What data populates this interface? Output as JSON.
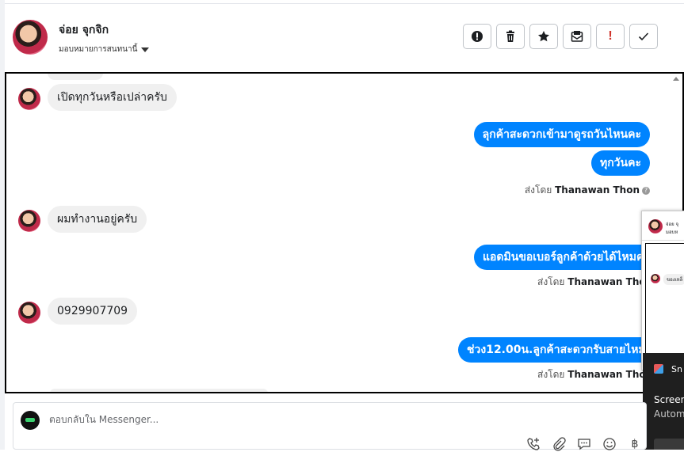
{
  "header": {
    "contact_name": "จ่อย จุกจิก",
    "assign_label": "มอบหมายการสนทนานี้",
    "toolbar": [
      {
        "icon": "alert-circle-icon",
        "label": ""
      },
      {
        "icon": "trash-icon",
        "label": ""
      },
      {
        "icon": "star-icon",
        "label": ""
      },
      {
        "icon": "mark-unread-icon",
        "label": ""
      },
      {
        "icon": "exclamation-icon",
        "label": "!"
      },
      {
        "icon": "checkmark-icon",
        "label": ""
      }
    ]
  },
  "messages": [
    {
      "direction": "in",
      "text": "เปิดทุกวันหรือเปล่าครับ"
    },
    {
      "direction": "out",
      "text": "ลุกค้าสะดวกเข้ามาดูรถวันไหนคะ"
    },
    {
      "direction": "out",
      "text": "ทุกวันคะ"
    },
    {
      "direction": "meta",
      "prefix": "ส่งโดย",
      "name": "Thanawan Thon"
    },
    {
      "direction": "in",
      "text": "ผมทำงานอยู่ครับ"
    },
    {
      "direction": "out",
      "text": "แอดมินขอเบอร์ลูกค้าด้วยได้ไหมคะ"
    },
    {
      "direction": "meta",
      "prefix": "ส่งโดย",
      "name": "Thanawan Thon"
    },
    {
      "direction": "in",
      "text": "0929907709"
    },
    {
      "direction": "out",
      "text": "ช่วง12.00น.ลูกค้าสะดวกรับสายไหมคะ"
    },
    {
      "direction": "meta",
      "prefix": "ส่งโดย",
      "name": "Thanawan Thon"
    }
  ],
  "mini_window": {
    "name": "จ่อย จุ",
    "subtitle": "มอบห",
    "bubble": "ของเหล็"
  },
  "toast": {
    "app": "Sn",
    "title": "Screen",
    "body": "Autom"
  },
  "composer": {
    "placeholder": "ตอบกลับใน Messenger...",
    "icons": [
      "add-call-icon",
      "paperclip-icon",
      "chat-bubble-icon",
      "emoji-icon",
      "baht-icon"
    ]
  }
}
